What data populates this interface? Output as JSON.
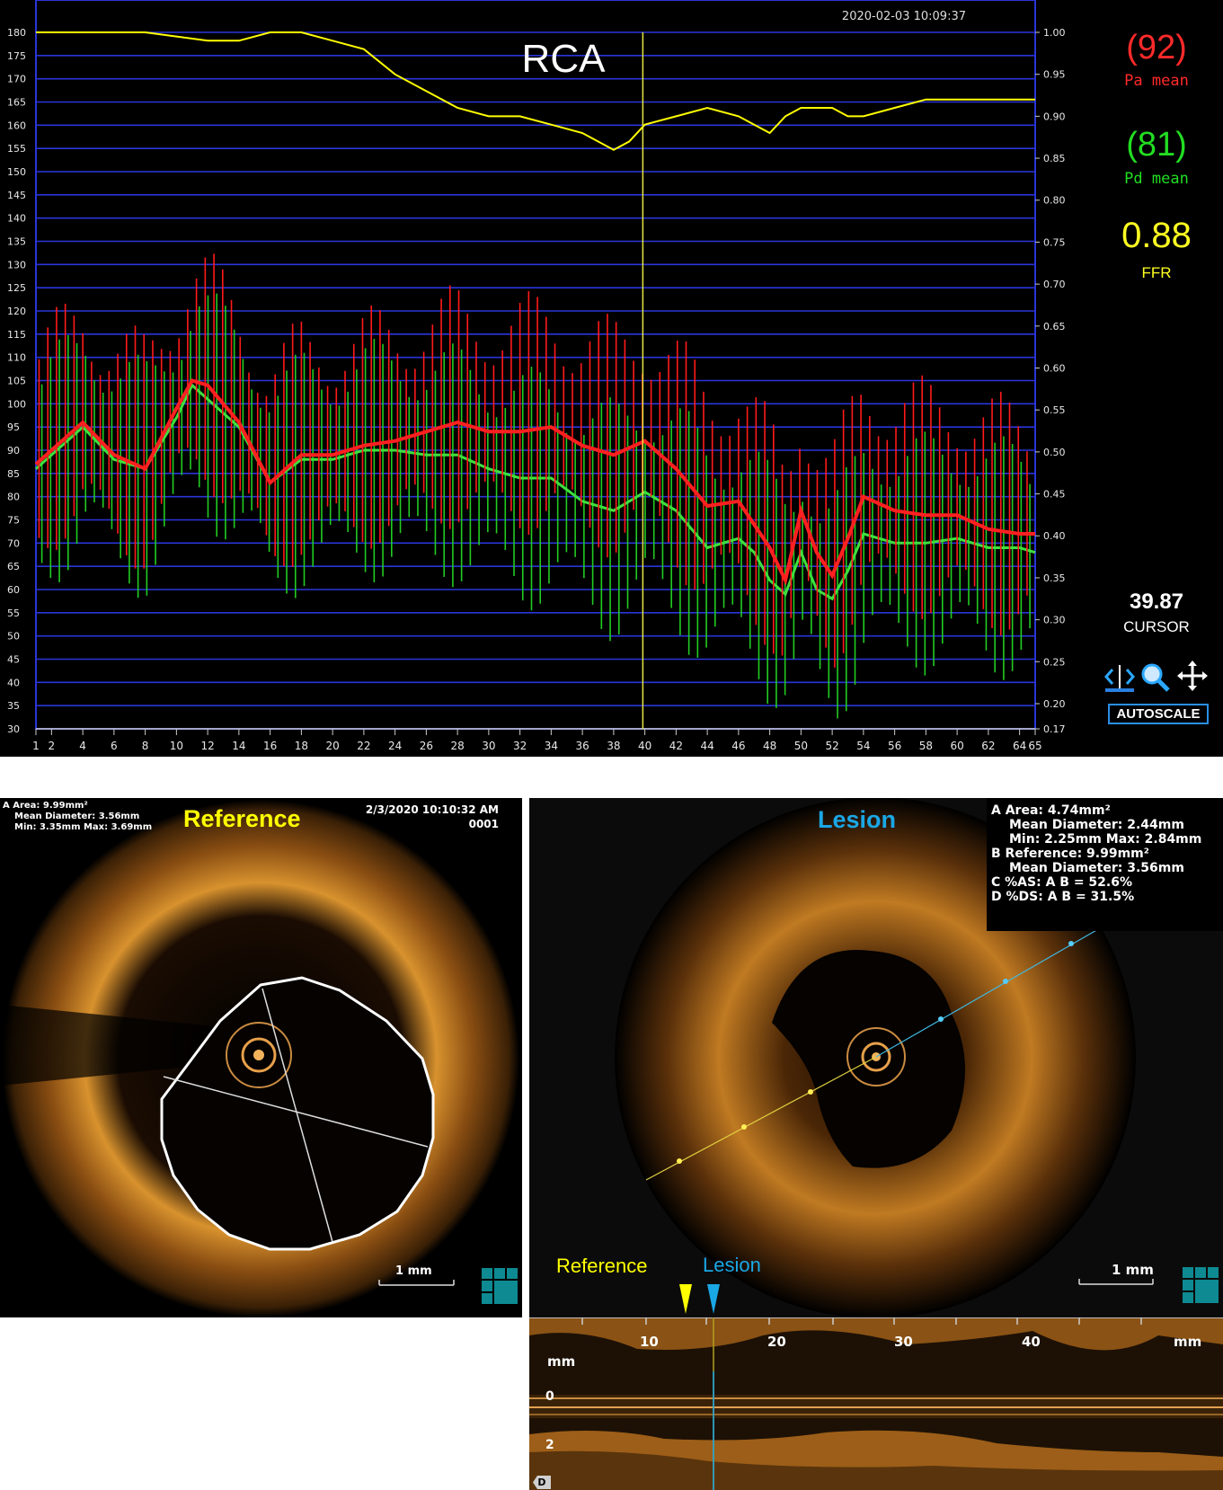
{
  "ffr": {
    "timestamp": "2020-02-03 10:09:37",
    "vessel": "RCA",
    "pa_mean_value": "(92)",
    "pa_mean_label": "Pa mean",
    "pd_mean_value": "(81)",
    "pd_mean_label": "Pd mean",
    "ffr_value": "0.88",
    "ffr_label": "FFR",
    "cursor_value": "39.87",
    "cursor_label": "CURSOR",
    "autoscale_label": "AUTOSCALE",
    "tools": [
      "cursor-tool-icon",
      "zoom-icon",
      "pan-icon"
    ],
    "colors": {
      "pa": "#ff1a1a",
      "pd": "#22cc22",
      "ffr": "#ffff00",
      "grid": "#2a35d8",
      "cursor": "#e6e640"
    }
  },
  "chart_data": {
    "type": "line",
    "title": "RCA",
    "xlabel": "",
    "ylabel": "",
    "xlim": [
      1,
      65
    ],
    "ylim": [
      30,
      180
    ],
    "y2lim": [
      0.17,
      1.0
    ],
    "x_ticks": [
      "1",
      "2",
      "4",
      "6",
      "8",
      "10",
      "12",
      "14",
      "16",
      "18",
      "20",
      "22",
      "24",
      "26",
      "28",
      "30",
      "32",
      "34",
      "36",
      "38",
      "40",
      "42",
      "44",
      "46",
      "48",
      "50",
      "52",
      "54",
      "56",
      "58",
      "60",
      "62",
      "64",
      "65"
    ],
    "y_ticks": [
      "180",
      "175",
      "170",
      "165",
      "160",
      "155",
      "150",
      "145",
      "140",
      "135",
      "130",
      "125",
      "120",
      "115",
      "110",
      "105",
      "100",
      "95",
      "90",
      "85",
      "80",
      "75",
      "70",
      "65",
      "60",
      "55",
      "50",
      "45",
      "40",
      "35",
      "30"
    ],
    "y2_ticks": [
      "1.00",
      "0.95",
      "0.90",
      "0.85",
      "0.80",
      "0.75",
      "0.70",
      "0.65",
      "0.60",
      "0.55",
      "0.50",
      "0.45",
      "0.40",
      "0.35",
      "0.30",
      "0.25",
      "0.20",
      "0.17"
    ],
    "cursor_x": 39.87,
    "grid": true,
    "series": [
      {
        "name": "Pa mean",
        "axis": "left",
        "x": [
          1,
          4,
          6,
          8,
          10,
          11,
          12,
          14,
          16,
          18,
          20,
          22,
          24,
          26,
          28,
          30,
          32,
          34,
          36,
          38,
          40,
          42,
          44,
          46,
          47,
          48,
          49,
          50,
          51,
          52,
          53,
          54,
          56,
          58,
          60,
          62,
          64,
          65
        ],
        "values": [
          87,
          96,
          89,
          86,
          99,
          105,
          104,
          96,
          83,
          89,
          89,
          91,
          92,
          94,
          96,
          94,
          94,
          95,
          91,
          89,
          92,
          86,
          78,
          79,
          74,
          69,
          62,
          77,
          68,
          63,
          71,
          80,
          77,
          76,
          76,
          73,
          72,
          72
        ]
      },
      {
        "name": "Pd mean",
        "axis": "left",
        "x": [
          1,
          4,
          6,
          8,
          10,
          11,
          12,
          14,
          16,
          18,
          20,
          22,
          24,
          26,
          28,
          30,
          32,
          34,
          36,
          38,
          40,
          42,
          44,
          46,
          47,
          48,
          49,
          50,
          51,
          52,
          53,
          54,
          56,
          58,
          60,
          62,
          64,
          65
        ],
        "values": [
          86,
          95,
          88,
          86,
          97,
          104,
          101,
          95,
          83,
          88,
          88,
          90,
          90,
          89,
          89,
          86,
          84,
          84,
          79,
          77,
          81,
          77,
          69,
          71,
          68,
          62,
          59,
          68,
          60,
          58,
          64,
          72,
          70,
          70,
          71,
          69,
          69,
          68
        ]
      },
      {
        "name": "FFR",
        "axis": "right",
        "x": [
          1,
          4,
          8,
          12,
          14,
          16,
          18,
          20,
          22,
          24,
          26,
          28,
          30,
          32,
          34,
          36,
          38,
          39,
          40,
          42,
          44,
          46,
          47,
          48,
          49,
          50,
          51,
          52,
          53,
          54,
          56,
          58,
          60,
          62,
          64,
          65
        ],
        "values": [
          1.0,
          1.0,
          1.0,
          0.99,
          0.99,
          1.0,
          1.0,
          0.99,
          0.98,
          0.95,
          0.93,
          0.91,
          0.9,
          0.9,
          0.89,
          0.88,
          0.86,
          0.87,
          0.89,
          0.9,
          0.91,
          0.9,
          0.89,
          0.88,
          0.9,
          0.91,
          0.91,
          0.91,
          0.9,
          0.9,
          0.91,
          0.92,
          0.92,
          0.92,
          0.92,
          0.92
        ]
      }
    ]
  },
  "reference_panel": {
    "title": "Reference",
    "measure_line1": "A Area: 9.99mm²",
    "measure_line2": "Mean Diameter:  3.56mm",
    "measure_line3": "Min:  3.35mm   Max:  3.69mm",
    "datetime": "2/3/2020 10:10:32 AM",
    "frame": "0001",
    "scale": "1 mm"
  },
  "lesion_panel": {
    "title": "Lesion",
    "measure_lines": [
      "A Area: 4.74mm²",
      "Mean Diameter:  2.44mm",
      "Min:  2.25mm   Max:  2.84mm",
      "B Reference: 9.99mm²",
      "Mean Diameter:  3.56mm",
      "C %AS: A B = 52.6%",
      "D %DS: A B = 31.5%"
    ],
    "scale": "1 mm",
    "marker_reference": "Reference",
    "marker_lesion": "Lesion",
    "colors": {
      "reference": "#ffff00",
      "lesion": "#1aa7e6"
    }
  },
  "longitudinal": {
    "x_ticks": [
      "10",
      "20",
      "30",
      "40"
    ],
    "unit_right": "mm",
    "unit_left": "mm",
    "depth_ticks": [
      "0",
      "2"
    ],
    "distal_badge": "D"
  }
}
